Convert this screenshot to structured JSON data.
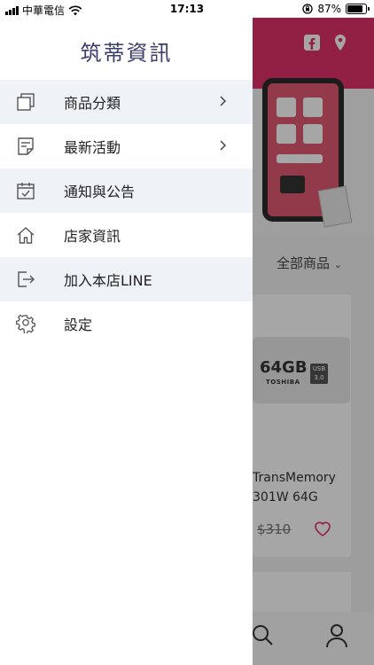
{
  "status_bar": {
    "carrier": "中華電信",
    "time": "17:13",
    "battery": "87%",
    "battery_level": 0.87
  },
  "drawer": {
    "title": "筑蒂資訊",
    "items": [
      {
        "label": "商品分類",
        "has_chevron": true,
        "icon": "square-stack-icon"
      },
      {
        "label": "最新活動",
        "has_chevron": true,
        "icon": "note-icon"
      },
      {
        "label": "通知與公告",
        "has_chevron": false,
        "icon": "calendar-check-icon"
      },
      {
        "label": "店家資訊",
        "has_chevron": false,
        "icon": "home-icon"
      },
      {
        "label": "加入本店LINE",
        "has_chevron": false,
        "icon": "exit-arrow-icon"
      },
      {
        "label": "設定",
        "has_chevron": false,
        "icon": "gear-icon"
      }
    ]
  },
  "background": {
    "filter_label": "全部商品",
    "usb_size": "64GB",
    "usb_brand": "TOSHIBA",
    "usb_badge": "USB 3.0",
    "product_name": "TransMemory 301W 64G",
    "product_price": "$310",
    "header_color": "#e1326b"
  }
}
